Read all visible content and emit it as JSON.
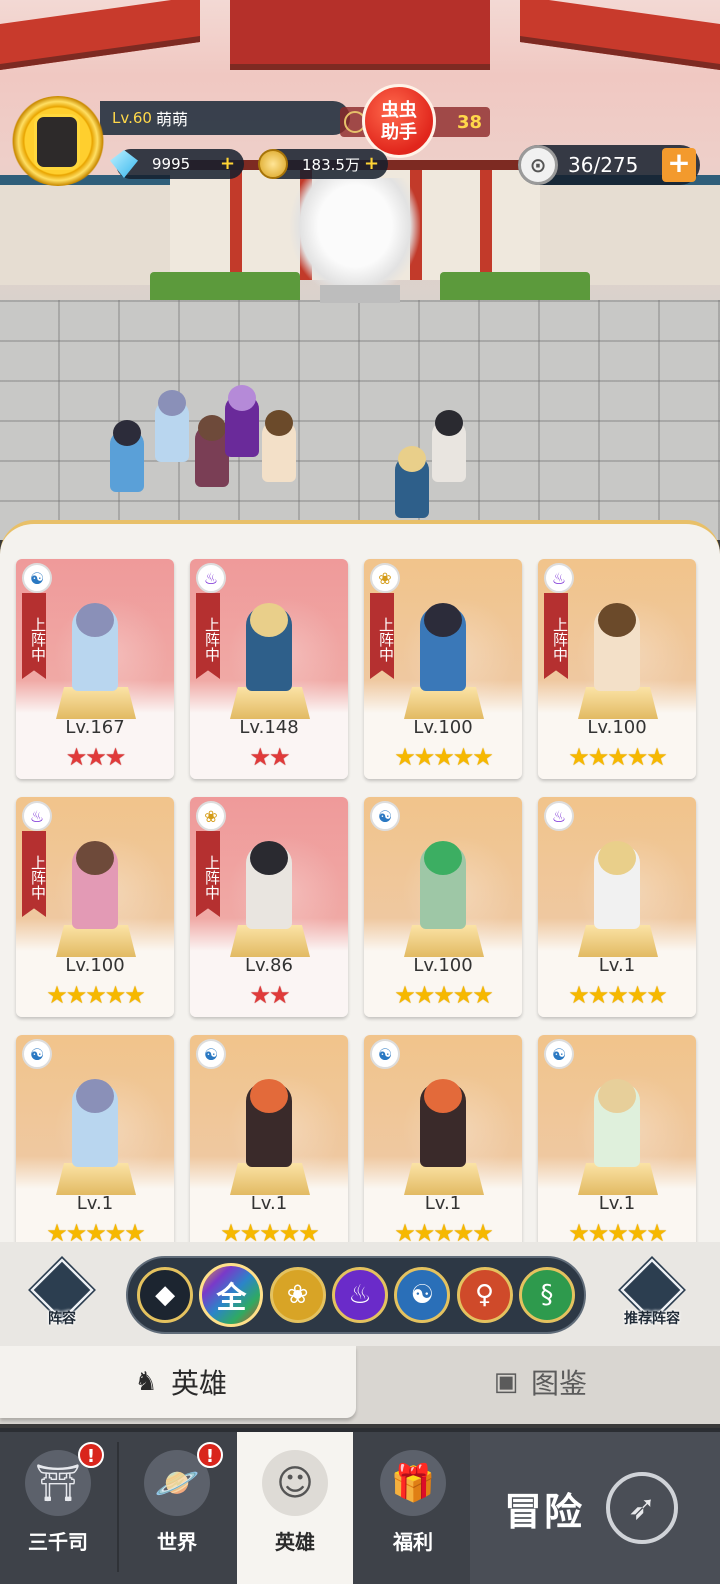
{
  "player": {
    "level": "Lv.60",
    "name": "萌萌",
    "power_partial": "38"
  },
  "assistant": {
    "line1": "虫虫",
    "line2": "助手"
  },
  "currency": {
    "gems": "9995",
    "coins": "183.5万",
    "plus": "+"
  },
  "roster": {
    "count": "36/275",
    "plus": "+"
  },
  "on_team_label": "上阵中",
  "heroes": [
    {
      "level": "Lv.167",
      "stars": "★★★",
      "star_color": "red",
      "faction": "swirl",
      "on_team": true,
      "card": "pink"
    },
    {
      "level": "Lv.148",
      "stars": "★★",
      "star_color": "red",
      "faction": "flame",
      "on_team": true,
      "card": "pink"
    },
    {
      "level": "Lv.100",
      "stars": "★★★★★",
      "star_color": "gold",
      "faction": "lotus",
      "on_team": true,
      "card": "gold"
    },
    {
      "level": "Lv.100",
      "stars": "★★★★★",
      "star_color": "gold",
      "faction": "flame",
      "on_team": true,
      "card": "gold"
    },
    {
      "level": "Lv.100",
      "stars": "★★★★★",
      "star_color": "gold",
      "faction": "flame",
      "on_team": true,
      "card": "gold"
    },
    {
      "level": "Lv.86",
      "stars": "★★",
      "star_color": "red",
      "faction": "lotus",
      "on_team": true,
      "card": "pink"
    },
    {
      "level": "Lv.100",
      "stars": "★★★★★",
      "star_color": "gold",
      "faction": "swirl",
      "on_team": false,
      "card": "gold"
    },
    {
      "level": "Lv.1",
      "stars": "★★★★★",
      "star_color": "gold",
      "faction": "flame",
      "on_team": false,
      "card": "gold"
    },
    {
      "level": "Lv.1",
      "stars": "★★★★★",
      "star_color": "gold",
      "faction": "swirl",
      "on_team": false,
      "card": "gold"
    },
    {
      "level": "Lv.1",
      "stars": "★★★★★",
      "star_color": "gold",
      "faction": "swirl",
      "on_team": false,
      "card": "gold"
    },
    {
      "level": "Lv.1",
      "stars": "★★★★★",
      "star_color": "gold",
      "faction": "swirl",
      "on_team": false,
      "card": "gold"
    },
    {
      "level": "Lv.1",
      "stars": "★★★★★",
      "star_color": "gold",
      "faction": "swirl",
      "on_team": false,
      "card": "gold"
    }
  ],
  "filters": {
    "lineup_label": "阵容",
    "recommend_label": "推荐阵容",
    "all_label": "全",
    "selected": "all"
  },
  "tabs": {
    "heroes": "英雄",
    "guide": "图鉴",
    "active": "heroes"
  },
  "nav": {
    "items": [
      {
        "label": "三千司",
        "badge": "!"
      },
      {
        "label": "世界",
        "badge": "!"
      },
      {
        "label": "英雄",
        "active": true
      },
      {
        "label": "福利"
      }
    ],
    "adventure_label": "冒险"
  },
  "colors": {
    "accent_gold": "#f6b800",
    "team_red": "#b53030",
    "panel": "#f4f2ee",
    "nav_bg": "#3e4249"
  }
}
